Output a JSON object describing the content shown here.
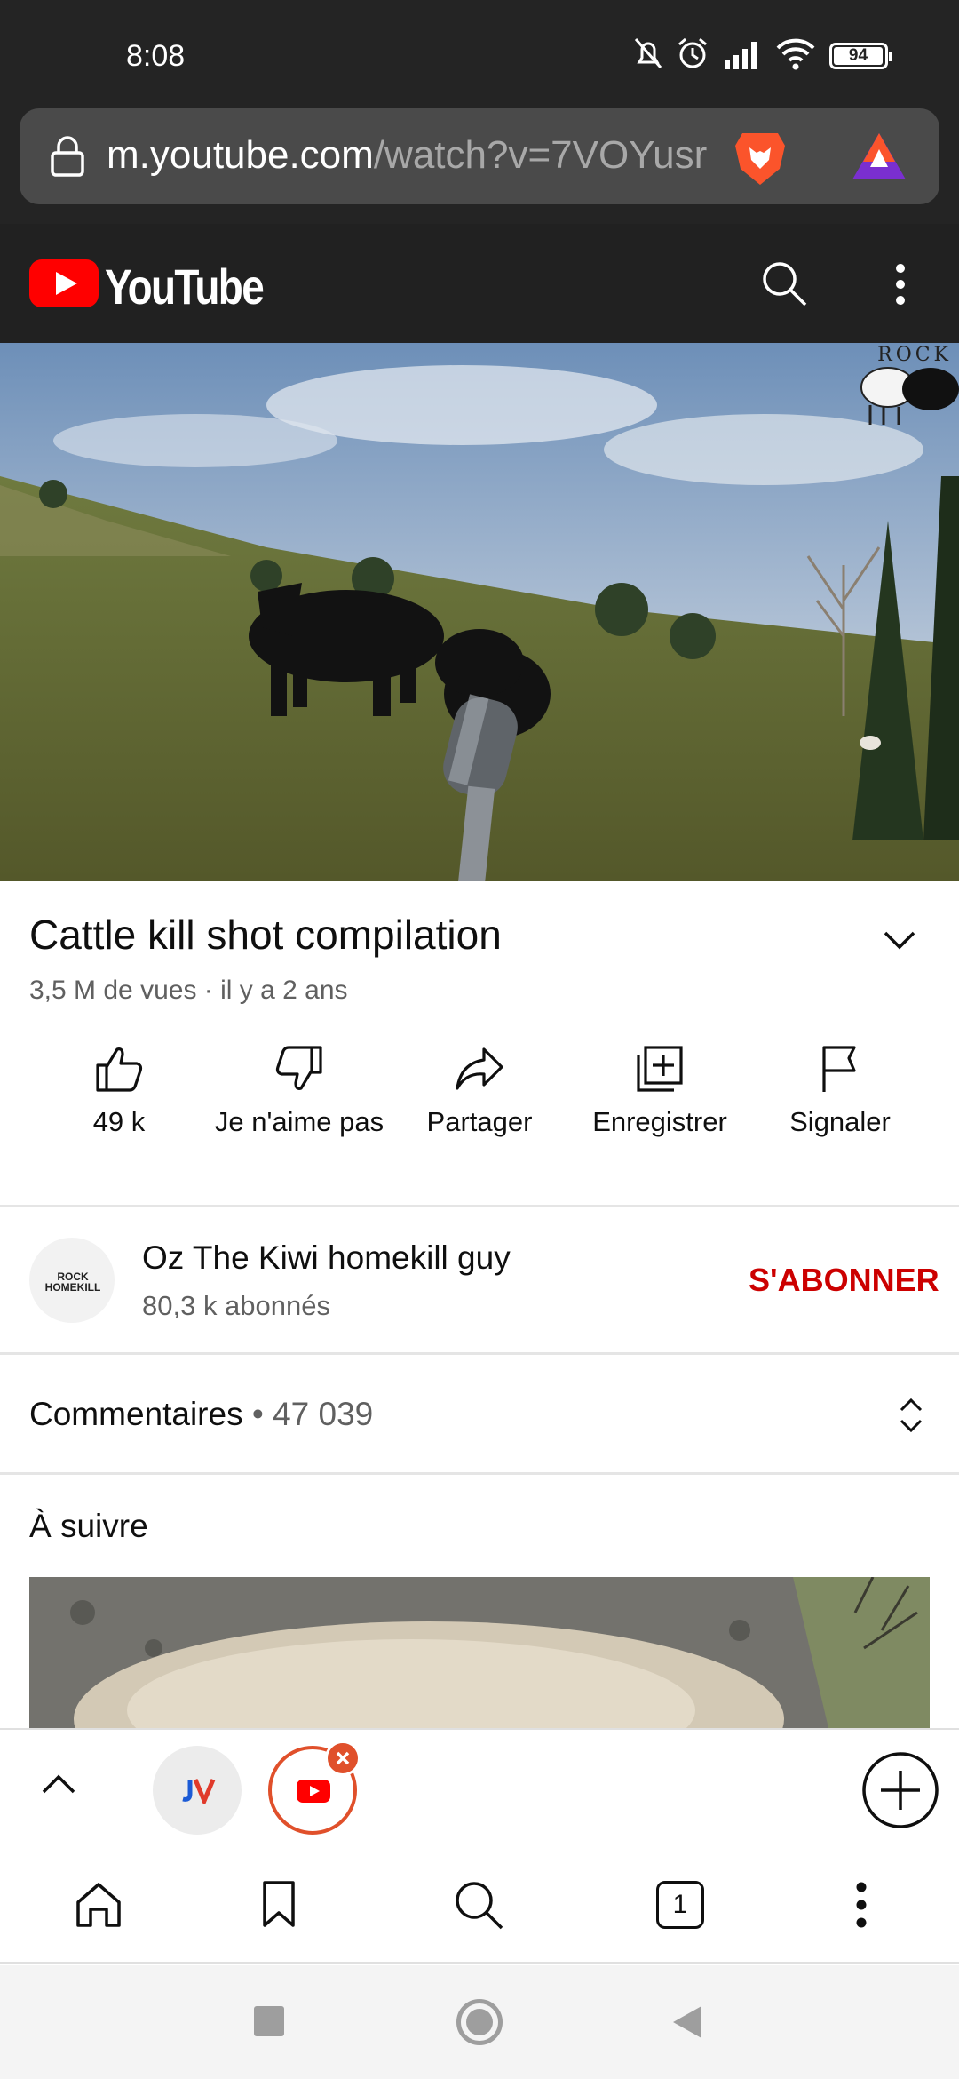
{
  "status_bar": {
    "time": "8:08",
    "battery": "94"
  },
  "browser": {
    "url_host": "m.youtube.com",
    "url_path": "/watch?v=7VOYusr"
  },
  "youtube": {
    "wordmark": "YouTube"
  },
  "video": {
    "watermark": "ROCK",
    "title": "Cattle kill shot compilation",
    "meta": "3,5 M de vues · il y a 2 ans",
    "actions": [
      {
        "label": "49 k"
      },
      {
        "label": "Je n'aime pas"
      },
      {
        "label": "Partager"
      },
      {
        "label": "Enregistrer"
      },
      {
        "label": "Signaler"
      }
    ]
  },
  "channel": {
    "name": "Oz The Kiwi homekill guy",
    "subscribers": "80,3 k abonnés",
    "subscribe_label": "S'ABONNER",
    "avatar_text": "ROCK HOMEKILL"
  },
  "comments": {
    "label": "Commentaires",
    "count": "• 47 039"
  },
  "up_next": {
    "label": "À suivre"
  },
  "tabs": {
    "count": "1"
  },
  "colors": {
    "accent_red": "#cc0000",
    "brave_orange": "#fb542b",
    "chrome_dark": "#242424"
  }
}
